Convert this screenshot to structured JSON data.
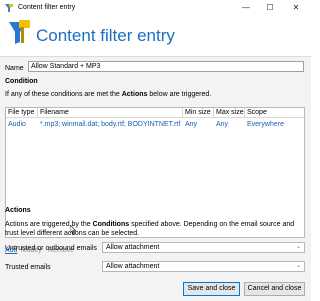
{
  "window": {
    "title": "Content filter entry",
    "minimize": "—",
    "maximize": "☐",
    "close": "✕"
  },
  "header": {
    "title": "Content filter entry"
  },
  "name": {
    "label": "Name",
    "value": "Allow Standard + MP3"
  },
  "condition": {
    "heading": "Condition",
    "desc_pre": "If any of these conditions are met the ",
    "desc_bold": "Actions",
    "desc_post": " below are triggered."
  },
  "table": {
    "columns": [
      "File type",
      "Filename",
      "Min size",
      "Max size",
      "Scope"
    ],
    "rows": [
      {
        "file_type": "Audio",
        "filename": "*.mp3; winmail.dat; body.rtf; BODYINTNET.rtf",
        "min_size": "Any",
        "max_size": "Any",
        "scope": "Everywhere"
      }
    ]
  },
  "links": {
    "add": "Add",
    "modify": "Modify",
    "remove": "Remove"
  },
  "actions": {
    "heading": "Actions",
    "desc_pre": "Actions are triggered by the ",
    "desc_bold": "Conditions",
    "desc_post": " specified above. Depending on the email source and",
    "desc_line2": "trust level different actions can be selected.",
    "untrusted_label": "Untrusted or outbound emails",
    "untrusted_value": "Allow attachment",
    "trusted_label": "Trusted emails",
    "trusted_value": "Allow attachment"
  },
  "buttons": {
    "save": "Save and close",
    "cancel": "Cancel and close"
  },
  "colors": {
    "accent": "#1a6fc4",
    "link": "#1a5fb4",
    "panel": "#f3f3f3"
  }
}
